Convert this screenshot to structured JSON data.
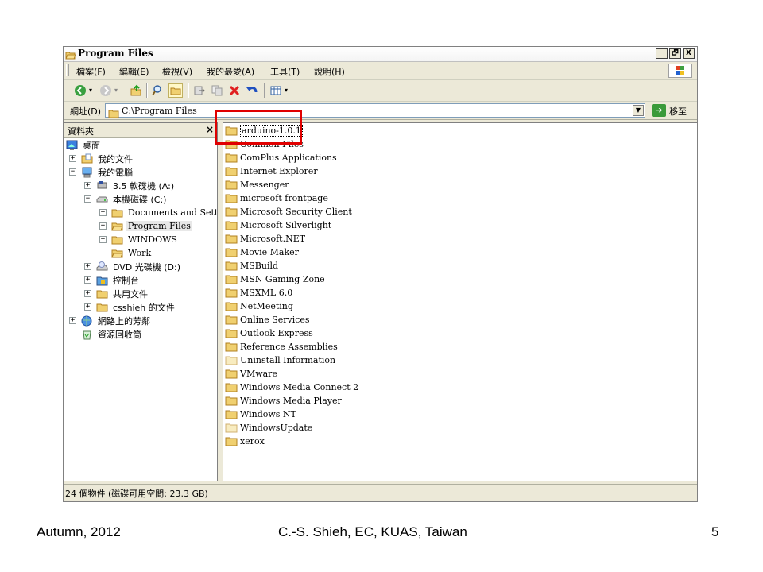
{
  "window": {
    "title": "Program Files",
    "buttons": [
      "_",
      "🗗",
      "X"
    ]
  },
  "menu": [
    "檔案(F)",
    "編輯(E)",
    "檢視(V)",
    "我的最愛(A)",
    "工具(T)",
    "說明(H)"
  ],
  "address": {
    "label": "網址(D)",
    "value": "C:\\Program Files",
    "go_label": "移至"
  },
  "folders_pane": {
    "title": "資料夾",
    "close": "×",
    "tree": [
      {
        "label": "桌面"
      },
      {
        "label": "我的文件",
        "expander": "+"
      },
      {
        "label": "我的電腦",
        "expander": "−"
      },
      {
        "label": "3.5 軟碟機 (A:)",
        "expander": "+"
      },
      {
        "label": "本機磁碟 (C:)",
        "expander": "−"
      },
      {
        "label": "Documents and Settings",
        "expander": "+"
      },
      {
        "label": "Program Files",
        "expander": "+"
      },
      {
        "label": "WINDOWS",
        "expander": "+"
      },
      {
        "label": "Work"
      },
      {
        "label": "DVD 光碟機 (D:)",
        "expander": "+"
      },
      {
        "label": "控制台",
        "expander": "+"
      },
      {
        "label": "共用文件",
        "expander": "+"
      },
      {
        "label": "csshieh 的文件",
        "expander": "+"
      },
      {
        "label": "網路上的芳鄰",
        "expander": "+"
      },
      {
        "label": "資源回收筒"
      }
    ]
  },
  "files": [
    "arduino-1.0.1",
    "Common Files",
    "ComPlus Applications",
    "Internet Explorer",
    "Messenger",
    "microsoft frontpage",
    "Microsoft Security Client",
    "Microsoft Silverlight",
    "Microsoft.NET",
    "Movie Maker",
    "MSBuild",
    "MSN Gaming Zone",
    "MSXML 6.0",
    "NetMeeting",
    "Online Services",
    "Outlook Express",
    "Reference Assemblies",
    "Uninstall Information",
    "VMware",
    "Windows Media Connect 2",
    "Windows Media Player",
    "Windows NT",
    "WindowsUpdate",
    "xerox"
  ],
  "status": "24 個物件 (磁碟可用空間: 23.3 GB)",
  "footer": {
    "left": "Autumn, 2012",
    "center": "C.-S. Shieh, EC, KUAS, Taiwan",
    "page": "5"
  },
  "colors": {
    "highlight": "#e00000",
    "folder": "#f0d070",
    "window_bg": "#ece9d8"
  }
}
